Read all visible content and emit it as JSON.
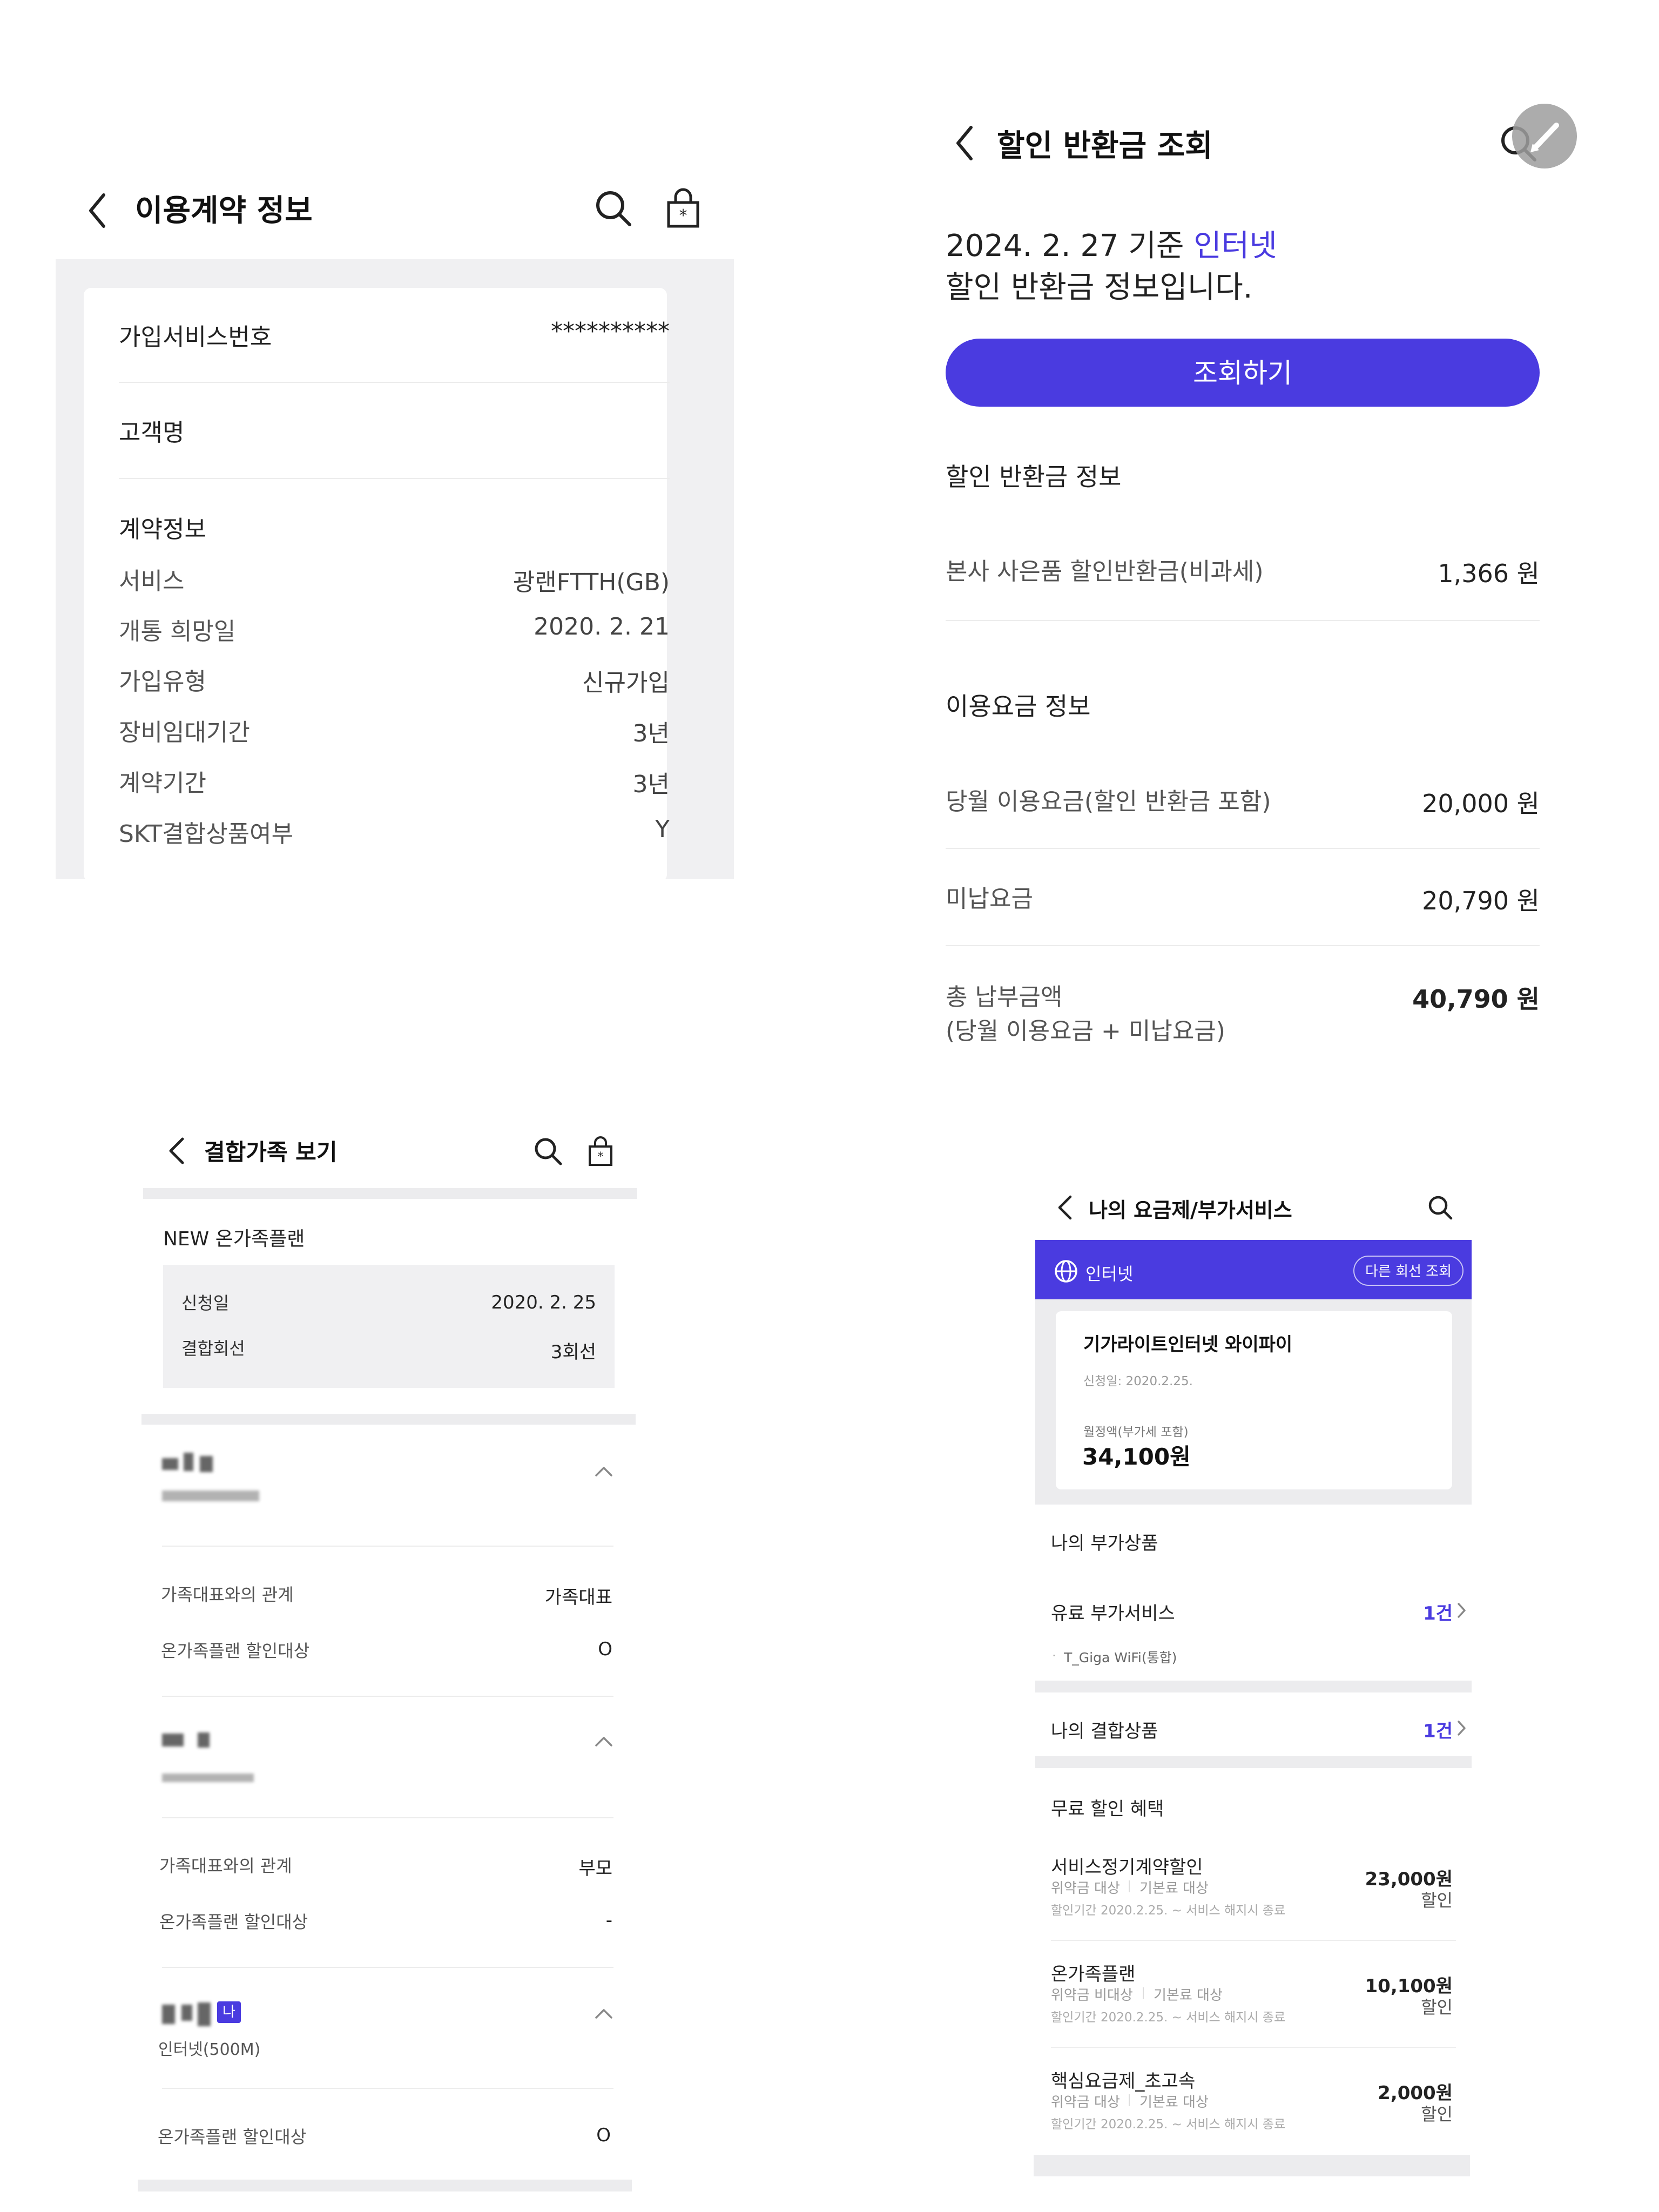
{
  "colors": {
    "accent": "#4a3be0",
    "gray_bg": "#f0f0f2"
  },
  "contract": {
    "title": "이용계약 정보",
    "rows": [
      {
        "label": "가입서비스번호",
        "value": "**********"
      },
      {
        "label": "고객명",
        "value": ""
      }
    ],
    "section_title": "계약정보",
    "details": [
      {
        "label": "서비스",
        "value": "광랜FTTH(GB)"
      },
      {
        "label": "개통 희망일",
        "value": "2020. 2. 21"
      },
      {
        "label": "가입유형",
        "value": "신규가입"
      },
      {
        "label": "장비임대기간",
        "value": "3년"
      },
      {
        "label": "계약기간",
        "value": "3년"
      },
      {
        "label": "SKT결합상품여부",
        "value": "Y"
      }
    ]
  },
  "refund": {
    "title": "할인 반환금 조회",
    "headline_prefix": "2024. 2. 27 기준 ",
    "headline_highlight": "인터넷",
    "headline_line2": "할인 반환금 정보입니다.",
    "button_label": "조회하기",
    "section1_title": "할인 반환금 정보",
    "section1_rows": [
      {
        "label": "본사 사은품 할인반환금(비과세)",
        "value": "1,366 원"
      }
    ],
    "section2_title": "이용요금 정보",
    "section2_rows": [
      {
        "label": "당월 이용요금(할인 반환금 포함)",
        "value": "20,000 원"
      },
      {
        "label": "미납요금",
        "value": "20,790 원"
      }
    ],
    "total_label_line1": "총 납부금액",
    "total_label_line2": "(당월 이용요금 + 미납요금)",
    "total_value": "40,790 원"
  },
  "family": {
    "title": "결합가족 보기",
    "plan_name": "NEW 온가족플랜",
    "summary": [
      {
        "label": "신청일",
        "value": "2020. 2. 25"
      },
      {
        "label": "결합회선",
        "value": "3회선"
      }
    ],
    "members": [
      {
        "rows": [
          {
            "label": "가족대표와의 관계",
            "value": "가족대표"
          },
          {
            "label": "온가족플랜 할인대상",
            "value": "O"
          }
        ]
      },
      {
        "rows": [
          {
            "label": "가족대표와의 관계",
            "value": "부모"
          },
          {
            "label": "온가족플랜 할인대상",
            "value": "-"
          }
        ]
      },
      {
        "badge": "나",
        "subtitle": "인터넷(500M)",
        "rows": [
          {
            "label": "온가족플랜 할인대상",
            "value": "O"
          }
        ]
      }
    ]
  },
  "plan": {
    "title": "나의 요금제/부가서비스",
    "tab_label": "인터넷",
    "other_line_button": "다른 회선 조회",
    "plan_name": "기가라이트인터넷 와이파이",
    "apply_date": "신청일: 2020.2.25.",
    "fee_label": "월정액(부가세 포함)",
    "fee_value": "34,100원",
    "addon_title": "나의 부가상품",
    "paid_addon_label": "유료 부가서비스",
    "paid_addon_count": "1건",
    "paid_addon_item": "T_Giga WiFi(통합)",
    "bundle_label": "나의 결합상품",
    "bundle_count": "1건",
    "discount_title": "무료 할인 혜택",
    "discounts": [
      {
        "name": "서비스정기계약할인",
        "tag1": "위약금 대상",
        "tag2": "기본료 대상",
        "period": "할인기간  2020.2.25. ~ 서비스 해지시 종료",
        "amount": "23,000원",
        "unit": "할인"
      },
      {
        "name": "온가족플랜",
        "tag1": "위약금 비대상",
        "tag2": "기본료 대상",
        "period": "할인기간  2020.2.25. ~ 서비스 해지시 종료",
        "amount": "10,100원",
        "unit": "할인"
      },
      {
        "name": "핵심요금제_초고속",
        "tag1": "위약금 대상",
        "tag2": "기본료 대상",
        "period": "할인기간  2020.2.25. ~ 서비스 해지시 종료",
        "amount": "2,000원",
        "unit": "할인"
      }
    ]
  }
}
